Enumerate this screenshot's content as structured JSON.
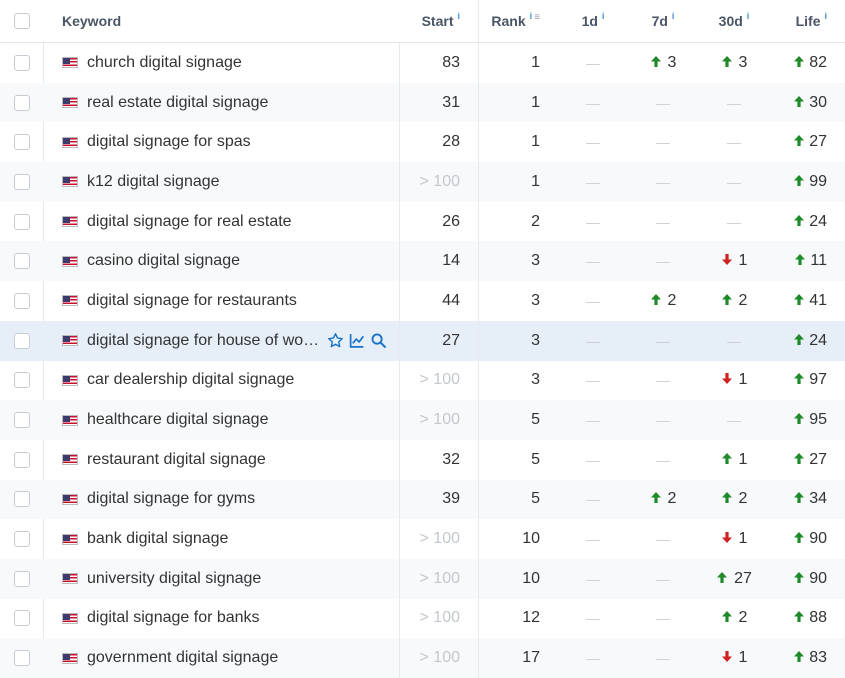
{
  "header": {
    "keyword": "Keyword",
    "start": "Start",
    "rank": "Rank",
    "d1": "1d",
    "d7": "7d",
    "d30": "30d",
    "life": "Life",
    "info_glyph": "i",
    "sort_glyph": "≡"
  },
  "dash": "—",
  "rows": [
    {
      "keyword": "church digital signage",
      "start": "83",
      "rank": "1",
      "d1": null,
      "d7": {
        "dir": "up",
        "v": "3"
      },
      "d30": {
        "dir": "up",
        "v": "3"
      },
      "life": "82"
    },
    {
      "keyword": "real estate digital signage",
      "start": "31",
      "rank": "1",
      "d1": null,
      "d7": null,
      "d30": null,
      "life": "30"
    },
    {
      "keyword": "digital signage for spas",
      "start": "28",
      "rank": "1",
      "d1": null,
      "d7": null,
      "d30": null,
      "life": "27"
    },
    {
      "keyword": "k12 digital signage",
      "start": "> 100",
      "rank": "1",
      "d1": null,
      "d7": null,
      "d30": null,
      "life": "99"
    },
    {
      "keyword": "digital signage for real estate",
      "start": "26",
      "rank": "2",
      "d1": null,
      "d7": null,
      "d30": null,
      "life": "24"
    },
    {
      "keyword": "casino digital signage",
      "start": "14",
      "rank": "3",
      "d1": null,
      "d7": null,
      "d30": {
        "dir": "down",
        "v": "1"
      },
      "life": "11"
    },
    {
      "keyword": "digital signage for restaurants",
      "start": "44",
      "rank": "3",
      "d1": null,
      "d7": {
        "dir": "up",
        "v": "2"
      },
      "d30": {
        "dir": "up",
        "v": "2"
      },
      "life": "41"
    },
    {
      "keyword": "digital signage for house of wo…",
      "start": "27",
      "rank": "3",
      "d1": null,
      "d7": null,
      "d30": null,
      "life": "24",
      "highlight": true
    },
    {
      "keyword": "car dealership digital signage",
      "start": "> 100",
      "rank": "3",
      "d1": null,
      "d7": null,
      "d30": {
        "dir": "down",
        "v": "1"
      },
      "life": "97"
    },
    {
      "keyword": "healthcare digital signage",
      "start": "> 100",
      "rank": "5",
      "d1": null,
      "d7": null,
      "d30": null,
      "life": "95"
    },
    {
      "keyword": "restaurant digital signage",
      "start": "32",
      "rank": "5",
      "d1": null,
      "d7": null,
      "d30": {
        "dir": "up",
        "v": "1"
      },
      "life": "27"
    },
    {
      "keyword": "digital signage for gyms",
      "start": "39",
      "rank": "5",
      "d1": null,
      "d7": {
        "dir": "up",
        "v": "2"
      },
      "d30": {
        "dir": "up",
        "v": "2"
      },
      "life": "34"
    },
    {
      "keyword": "bank digital signage",
      "start": "> 100",
      "rank": "10",
      "d1": null,
      "d7": null,
      "d30": {
        "dir": "down",
        "v": "1"
      },
      "life": "90"
    },
    {
      "keyword": "university digital signage",
      "start": "> 100",
      "rank": "10",
      "d1": null,
      "d7": null,
      "d30": {
        "dir": "up",
        "v": "27"
      },
      "life": "90"
    },
    {
      "keyword": "digital signage for banks",
      "start": "> 100",
      "rank": "12",
      "d1": null,
      "d7": null,
      "d30": {
        "dir": "up",
        "v": "2"
      },
      "life": "88"
    },
    {
      "keyword": "government digital signage",
      "start": "> 100",
      "rank": "17",
      "d1": null,
      "d7": null,
      "d30": {
        "dir": "down",
        "v": "1"
      },
      "life": "83"
    }
  ],
  "icons": {
    "flag": "us-flag-icon",
    "up": "arrow-up-icon",
    "down": "arrow-down-icon",
    "star": "star-icon",
    "chart": "trend-chart-icon",
    "search": "search-icon"
  },
  "colors": {
    "up": "#1e8a2a",
    "down": "#d12020",
    "accent": "#1a73c9",
    "highlight_row": "#e6eef7"
  }
}
